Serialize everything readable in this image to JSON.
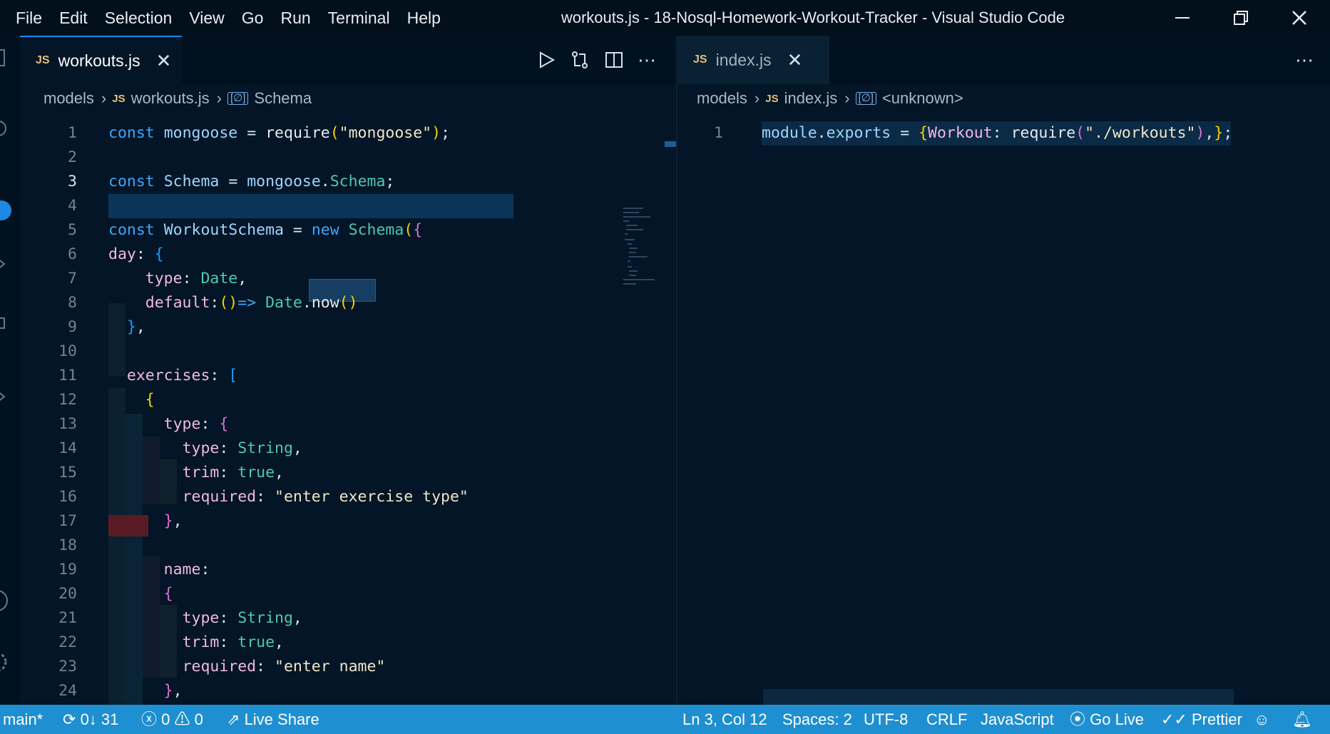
{
  "menu": [
    "File",
    "Edit",
    "Selection",
    "View",
    "Go",
    "Run",
    "Terminal",
    "Help"
  ],
  "window_title": "workouts.js - 18-Nosql-Homework-Workout-Tracker - Visual Studio Code",
  "left_editor": {
    "tab": {
      "icon": "JS",
      "label": "workouts.js"
    },
    "breadcrumb": {
      "folder": "models",
      "file": "workouts.js",
      "symbol": "Schema"
    }
  },
  "right_editor": {
    "tab": {
      "icon": "JS",
      "label": "index.js"
    },
    "breadcrumb": {
      "folder": "models",
      "file": "index.js",
      "symbol": "<unknown>"
    }
  },
  "statusbar": {
    "branch": "main*",
    "sync": "0↓ 31",
    "errors": "0",
    "warnings": "0",
    "live_share": "Live Share",
    "position": "Ln 3, Col 12",
    "spaces": "Spaces: 2",
    "encoding": "UTF-8",
    "eol": "CRLF",
    "language": "JavaScript",
    "go_live": "Go Live",
    "prettier": "Prettier"
  },
  "icons": {
    "run": "play-icon",
    "compare": "compare-changes-icon",
    "split": "split-editor-icon",
    "more": "more-actions-icon",
    "minimize": "minimize-icon",
    "restore": "restore-icon",
    "close": "close-icon"
  },
  "colors": {
    "background": "#031526",
    "statusbar": "#1e8fd0",
    "keyword": "#3aa8ff",
    "string": "#f0e6c8"
  }
}
